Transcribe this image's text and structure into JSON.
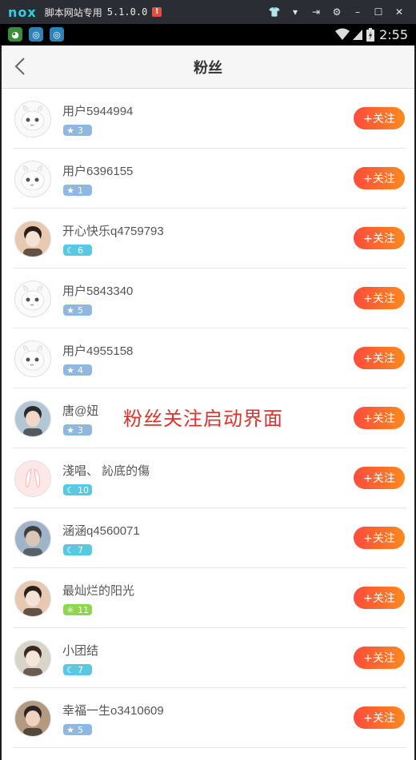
{
  "emulator": {
    "logo": "nox",
    "title": "脚本网站专用",
    "version": "5.1.0.0",
    "warn": "!"
  },
  "status_bar": {
    "time": "2:55"
  },
  "header": {
    "title": "粉丝"
  },
  "overlay": {
    "text": "粉丝关注启动界面"
  },
  "colors": {
    "badge_star": "#8fb7df",
    "badge_moon": "#5ac8e0",
    "badge_sun": "#8fd64a",
    "follow_start": "#ff4b3b",
    "follow_end": "#ff8a1e"
  },
  "follow_label": "+关注",
  "fans": [
    {
      "name": "用户5944994",
      "badge_icon": "star-icon",
      "level": "3",
      "avatar": "default"
    },
    {
      "name": "用户6396155",
      "badge_icon": "star-icon",
      "level": "1",
      "avatar": "default"
    },
    {
      "name": "开心快乐q4759793",
      "badge_icon": "moon-icon",
      "level": "6",
      "avatar": "photo"
    },
    {
      "name": "用户5843340",
      "badge_icon": "star-icon",
      "level": "5",
      "avatar": "default"
    },
    {
      "name": "用户4955158",
      "badge_icon": "star-icon",
      "level": "4",
      "avatar": "default"
    },
    {
      "name": "唐@妞",
      "badge_icon": "star-icon",
      "level": "3",
      "avatar": "photo"
    },
    {
      "name": "淺唱、 訫底的傷",
      "badge_icon": "moon-icon",
      "level": "10",
      "avatar": "bunny"
    },
    {
      "name": "涵涵q4560071",
      "badge_icon": "moon-icon",
      "level": "7",
      "avatar": "photo"
    },
    {
      "name": "最灿烂的阳光",
      "badge_icon": "sun-icon",
      "level": "11",
      "avatar": "photo"
    },
    {
      "name": "小团结",
      "badge_icon": "moon-icon",
      "level": "7",
      "avatar": "photo"
    },
    {
      "name": "幸福一生o3410609",
      "badge_icon": "star-icon",
      "level": "5",
      "avatar": "photo"
    }
  ]
}
